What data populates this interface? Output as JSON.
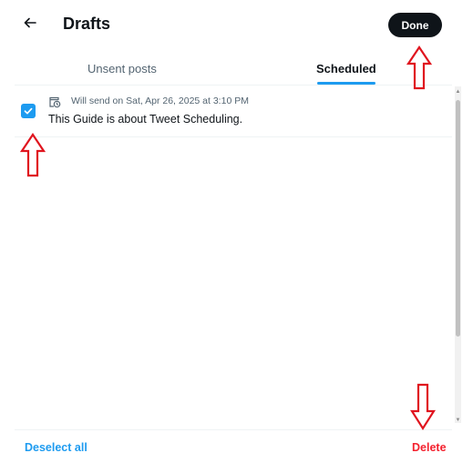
{
  "header": {
    "back_icon": "arrow-left-icon",
    "title": "Drafts",
    "done_label": "Done"
  },
  "tabs": [
    {
      "label": "Unsent posts",
      "selected": false
    },
    {
      "label": "Scheduled",
      "selected": true
    }
  ],
  "draft": {
    "checked": true,
    "schedule_icon": "calendar-clock-icon",
    "meta": "Will send on Sat, Apr 26, 2025 at 3:10 PM",
    "text": "This Guide is about Tweet Scheduling."
  },
  "footer": {
    "deselect_label": "Deselect all",
    "delete_label": "Delete"
  },
  "annotations": {
    "arrow_color": "#e0141e",
    "arrows": [
      "up-arrow-annotation",
      "up-arrow-annotation",
      "down-arrow-annotation"
    ]
  },
  "colors": {
    "accent": "#1d9bf0",
    "danger": "#f4212e",
    "text": "#0f1419",
    "muted": "#536471"
  }
}
